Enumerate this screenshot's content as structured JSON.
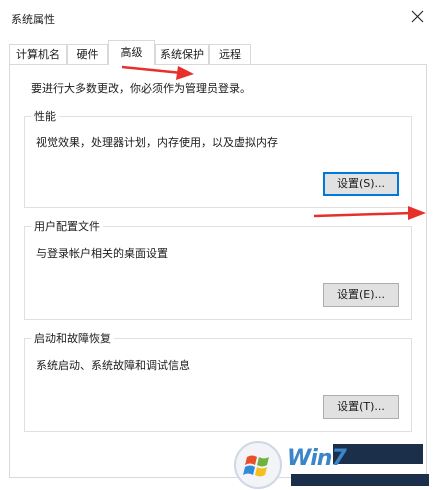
{
  "window": {
    "title": "系统属性",
    "close_icon": "close-icon"
  },
  "tabs": [
    {
      "label": "计算机名"
    },
    {
      "label": "硬件"
    },
    {
      "label": "高级"
    },
    {
      "label": "系统保护"
    },
    {
      "label": "远程"
    }
  ],
  "active_tab": "高级",
  "notice": "要进行大多数更改，你必须作为管理员登录。",
  "groups": {
    "performance": {
      "title": "性能",
      "desc": "视觉效果，处理器计划，内存使用，以及虚拟内存",
      "button": "设置(S)..."
    },
    "profiles": {
      "title": "用户配置文件",
      "desc": "与登录帐户相关的桌面设置",
      "button": "设置(E)..."
    },
    "startup": {
      "title": "启动和故障恢复",
      "desc": "系统启动、系统故障和调试信息",
      "button": "设置(T)..."
    }
  },
  "annotation_color": "#e8302b",
  "watermark": {
    "text": "Win7"
  }
}
